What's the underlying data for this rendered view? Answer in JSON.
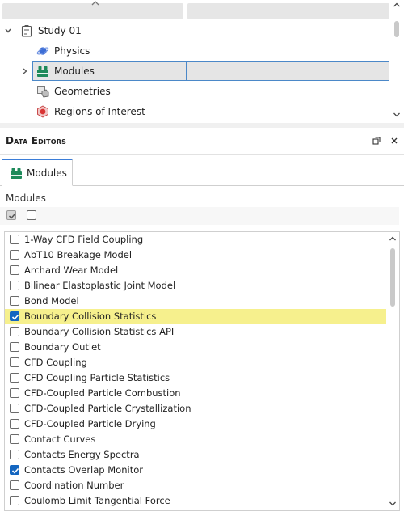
{
  "tree": {
    "root": {
      "label": "Study 01",
      "icon": "clipboard-icon"
    },
    "items": [
      {
        "label": "Physics",
        "icon": "planet-icon",
        "selected": false,
        "expandable": false
      },
      {
        "label": "Modules",
        "icon": "modules-icon",
        "selected": true,
        "expandable": true
      },
      {
        "label": "Geometries",
        "icon": "geometries-icon",
        "selected": false,
        "expandable": false
      },
      {
        "label": "Regions of Interest",
        "icon": "regions-icon",
        "selected": false,
        "expandable": false
      }
    ]
  },
  "data_editors": {
    "title": "Data Editors",
    "tab": {
      "label": "Modules",
      "icon": "modules-icon"
    },
    "section_label": "Modules",
    "colors": {
      "accent": "#1466c0",
      "highlight": "#f6f08d",
      "tab_border": "#3b7dd8",
      "module_icon": "#1e8a5a"
    },
    "modules": [
      {
        "label": "1-Way CFD Field Coupling",
        "checked": false,
        "highlighted": false
      },
      {
        "label": "AbT10 Breakage Model",
        "checked": false,
        "highlighted": false
      },
      {
        "label": "Archard Wear Model",
        "checked": false,
        "highlighted": false
      },
      {
        "label": "Bilinear Elastoplastic Joint Model",
        "checked": false,
        "highlighted": false
      },
      {
        "label": "Bond Model",
        "checked": false,
        "highlighted": false
      },
      {
        "label": "Boundary Collision Statistics",
        "checked": true,
        "highlighted": true
      },
      {
        "label": "Boundary Collision Statistics API",
        "checked": false,
        "highlighted": false
      },
      {
        "label": "Boundary Outlet",
        "checked": false,
        "highlighted": false
      },
      {
        "label": "CFD Coupling",
        "checked": false,
        "highlighted": false
      },
      {
        "label": "CFD Coupling Particle Statistics",
        "checked": false,
        "highlighted": false
      },
      {
        "label": "CFD-Coupled Particle Combustion",
        "checked": false,
        "highlighted": false
      },
      {
        "label": "CFD-Coupled Particle Crystallization",
        "checked": false,
        "highlighted": false
      },
      {
        "label": "CFD-Coupled Particle Drying",
        "checked": false,
        "highlighted": false
      },
      {
        "label": "Contact Curves",
        "checked": false,
        "highlighted": false
      },
      {
        "label": "Contacts Energy Spectra",
        "checked": false,
        "highlighted": false
      },
      {
        "label": "Contacts Overlap Monitor",
        "checked": true,
        "highlighted": false
      },
      {
        "label": "Coordination Number",
        "checked": false,
        "highlighted": false
      },
      {
        "label": "Coulomb Limit Tangential Force",
        "checked": false,
        "highlighted": false
      }
    ]
  }
}
